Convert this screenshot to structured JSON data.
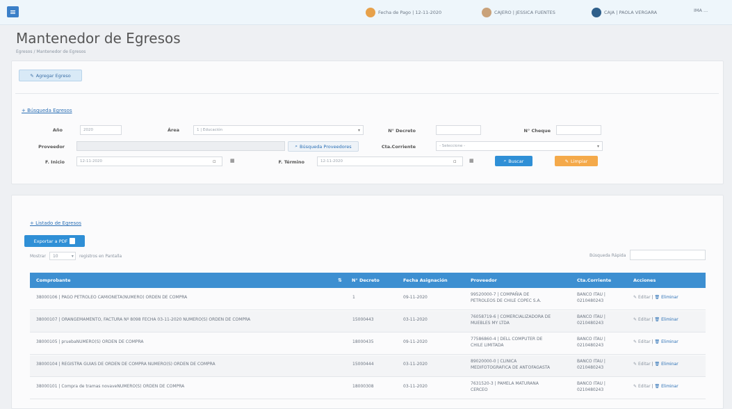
{
  "topbar": {
    "fecha_pago": "Fecha de Pago | 12-11-2020",
    "cajero": "CAJERO | JESSICA FUENTES",
    "caja": "CAJA | PAOLA VERGARA",
    "extra": "IMA ..."
  },
  "header": {
    "title": "Mantenedor de Egresos",
    "breadcrumb": "Egresos / Mantenedor de Egresos"
  },
  "actions": {
    "add_label": "Agregar Egreso"
  },
  "search": {
    "section_label": "+ Búsqueda Egresos",
    "anio_label": "Año",
    "anio_value": "2020",
    "area_label": "Área",
    "area_value": "1 | Educación",
    "decreto_label": "N° Decreto",
    "decreto_value": "",
    "cheque_label": "N° Cheque",
    "cheque_value": "",
    "proveedor_label": "Proveedor",
    "proveedor_value": "",
    "buscar_proveedor_label": "Búsqueda Proveedores",
    "cta_label": "Cta.Corriente",
    "cta_value": "- Seleccione -",
    "inicio_label": "F. Inicio",
    "inicio_value": "12-11-2020",
    "termino_label": "F. Término",
    "termino_value": "12-11-2020",
    "buscar_label": "Buscar",
    "limpiar_label": "Limpiar"
  },
  "listing": {
    "section_label": "+ Listado de Egresos",
    "export_label": "Exportar a PDF",
    "show_label": "Mostrar",
    "show_value": "10",
    "per_page_label": "registros en Pantalla",
    "quick_search_label": "Búsqueda Rápida",
    "quick_search_value": ""
  },
  "table": {
    "headers": [
      "Comprobante",
      "N° Decreto",
      "Fecha Asignación",
      "Proveedor",
      "Cta.Corriente",
      "Acciones"
    ],
    "edit_label": "Editar",
    "delete_label": "Eliminar",
    "rows": [
      {
        "comprobante": "38000106 | PAGO PETROLEO CAMIONETA(NUMERO) ORDEN DE COMPRA",
        "decreto": "1",
        "fecha": "09-11-2020",
        "proveedor": "99520000-7 | COMPAÑIA DE PETROLEOS DE CHILE COPEC S.A.",
        "cta": "BANCO ITAU | 0210480243"
      },
      {
        "comprobante": "38000107 | ORANGEMAMENTO, FACTURA Nº 8098 FECHA 03-11-2020 NUMERO(S) ORDEN DE COMPRA",
        "decreto": "15000443",
        "fecha": "03-11-2020",
        "proveedor": "76058719-6 | COMERCIALIZADORA DE MUEBLES MY LTDA",
        "cta": "BANCO ITAU | 0210480243"
      },
      {
        "comprobante": "38000105 | pruebaNUMERO(S) ORDEN DE COMPRA",
        "decreto": "18000435",
        "fecha": "09-11-2020",
        "proveedor": "77586860-4 | DELL COMPUTER DE CHILE LIMITADA",
        "cta": "BANCO ITAU | 0210480243"
      },
      {
        "comprobante": "38000104 | REGISTRA GUIAS DE ORDEN DE COMPRA NUMERO(S) ORDEN DE COMPRA",
        "decreto": "15000444",
        "fecha": "03-11-2020",
        "proveedor": "89020000-0 | CLINICA MEDIFOTOGRAFICA DE ANTOFAGASTA",
        "cta": "BANCO ITAU | 0210480243"
      },
      {
        "comprobante": "38000101 | Compra de tramas novaveNUMERO(S) ORDEN DE COMPRA",
        "decreto": "18000308",
        "fecha": "03-11-2020",
        "proveedor": "7631520-3 | PAMELA MATURANA CERCEO",
        "cta": "BANCO ITAU | 0210480243"
      }
    ]
  },
  "colors": {
    "primary": "#3d8fd1",
    "accent": "#f4a94a",
    "link": "#2a6fb5"
  }
}
